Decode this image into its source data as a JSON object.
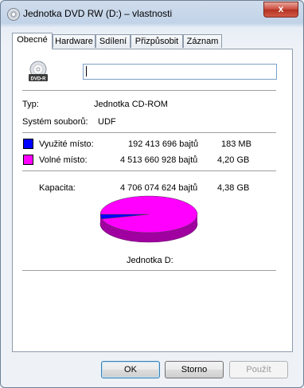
{
  "window": {
    "title": "Jednotka DVD RW (D:) – vlastnosti",
    "close_label": "x"
  },
  "tabs": [
    "Obecné",
    "Hardware",
    "Sdílení",
    "Přizpůsobit",
    "Záznam"
  ],
  "general": {
    "icon_label": "DVD-R",
    "name_value": "",
    "type_label": "Typ:",
    "type_value": "Jednotka CD-ROM",
    "fs_label": "Systém souborů:",
    "fs_value": "UDF",
    "used_label": "Využité místo:",
    "used_bytes": "192 413 696 bajtů",
    "used_size": "183 MB",
    "free_label": "Volné místo:",
    "free_bytes": "4 513 660 928 bajtů",
    "free_size": "4,20 GB",
    "capacity_label": "Kapacita:",
    "capacity_bytes": "4 706 074 624 bajtů",
    "capacity_size": "4,38 GB",
    "drive_label": "Jednotka D:"
  },
  "colors": {
    "used": "#0000ff",
    "free": "#ff00ff"
  },
  "chart_data": {
    "type": "pie",
    "categories": [
      "Využité místo",
      "Volné místo"
    ],
    "values": [
      192413696,
      4513660928
    ]
  },
  "buttons": {
    "ok": "OK",
    "cancel": "Storno",
    "apply": "Použít"
  }
}
